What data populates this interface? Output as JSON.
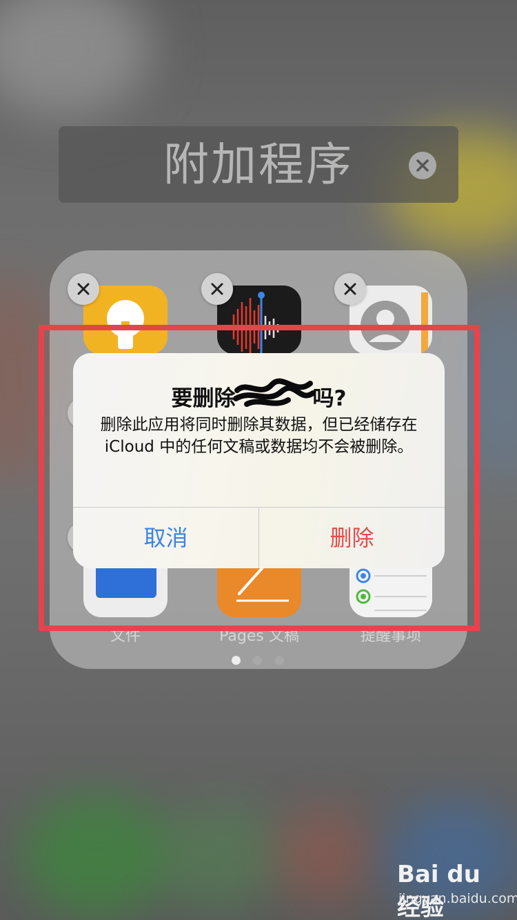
{
  "folder": {
    "title": "附加程序",
    "apps": [
      {
        "label": "",
        "icon": "tips-lightbulb-icon",
        "color": "#f2b323"
      },
      {
        "label": "",
        "icon": "voice-memos-waveform-icon",
        "color": "#1b1b1b"
      },
      {
        "label": "",
        "icon": "contacts-person-icon",
        "color": "#ececec"
      },
      {
        "label": "文件",
        "icon": "files-folder-icon",
        "color": "#2f70d8"
      },
      {
        "label": "Pages 文稿",
        "icon": "pages-pen-icon",
        "color": "#e9892a"
      },
      {
        "label": "提醒事项",
        "icon": "reminders-list-icon",
        "color": "#f3f3f3"
      }
    ],
    "page_count": 3,
    "current_page": 1
  },
  "alert": {
    "title_prefix": "要删除",
    "title_suffix": "吗?",
    "message": "删除此应用将同时删除其数据，但已经储存在 iCloud 中的任何文稿或数据均不会被删除。",
    "cancel_label": "取消",
    "delete_label": "删除"
  },
  "watermark": {
    "logo": "Bai du 经验",
    "url": "jingyan.baidu.com"
  },
  "colors": {
    "highlight": "#e8434d",
    "cancel": "#3d82e6",
    "delete": "#e84a4a"
  }
}
